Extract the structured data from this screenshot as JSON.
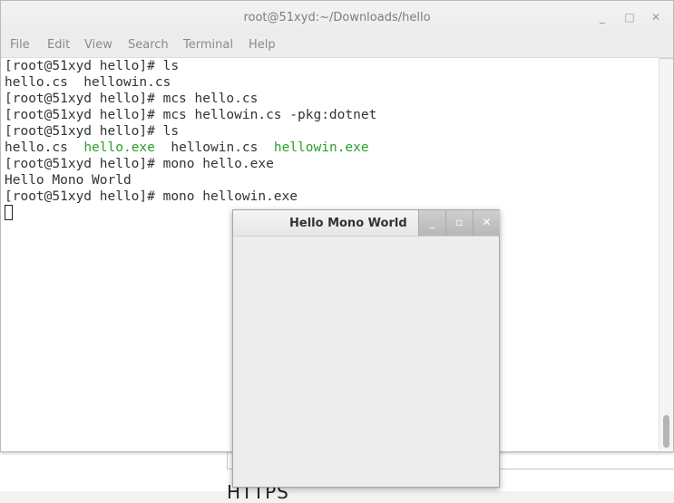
{
  "terminal": {
    "title": "root@51xyd:~/Downloads/hello",
    "menu": [
      "File",
      "Edit",
      "View",
      "Search",
      "Terminal",
      "Help"
    ],
    "lines": [
      "[root@51xyd hello]# ls",
      "hello.cs  hellowin.cs",
      "[root@51xyd hello]# mcs hello.cs",
      "[root@51xyd hello]# mcs hellowin.cs -pkg:dotnet",
      "[root@51xyd hello]# ls",
      null,
      "[root@51xyd hello]# mono hello.exe",
      "Hello Mono World",
      "[root@51xyd hello]# mono hellowin.exe"
    ],
    "ls_output": {
      "file1": "hello.cs",
      "exe1": "hello.exe",
      "file2": "hellowin.cs",
      "exe2": "hellowin.exe"
    },
    "window_buttons": {
      "minimize": "_",
      "maximize": "□",
      "close": "✕"
    }
  },
  "hello_window": {
    "title": "Hello Mono World",
    "buttons": {
      "minimize": "_",
      "maximize": "▫",
      "close": "✕"
    }
  },
  "background": {
    "text": "HTTPS"
  },
  "colors": {
    "exe_green": "#2aa02a",
    "terminal_text": "#2e3436"
  }
}
